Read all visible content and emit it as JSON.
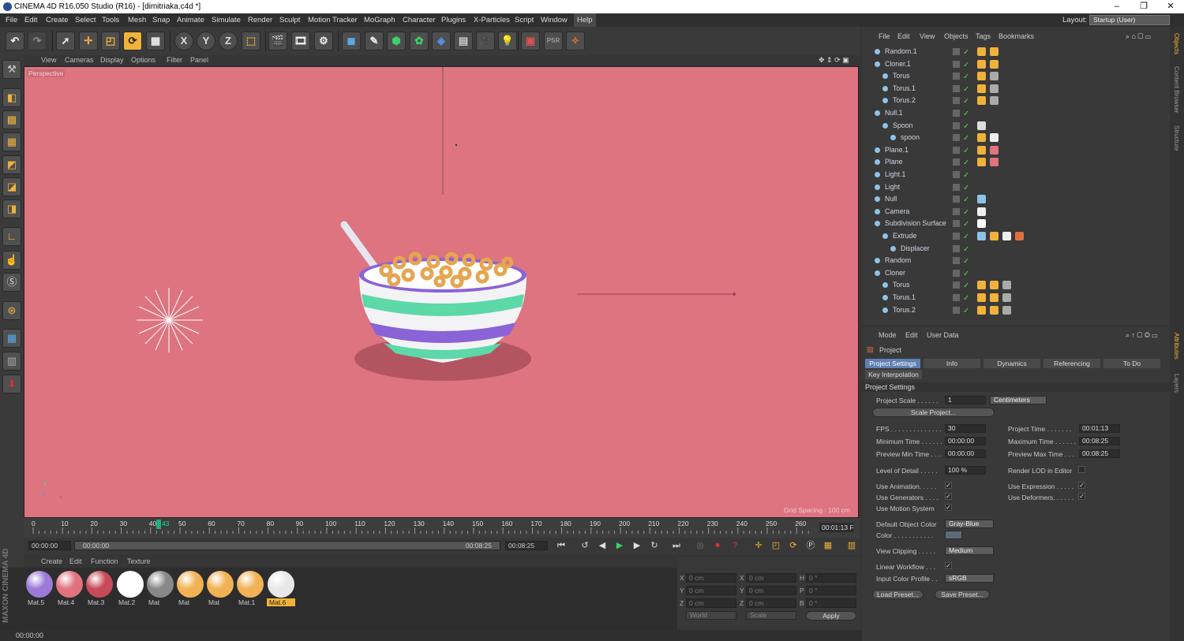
{
  "window": {
    "title": "CINEMA 4D R16.050 Studio (R16) - [dimitriaka.c4d *]",
    "minimize": "–",
    "maximize": "❐",
    "close": "✕"
  },
  "menu": [
    "File",
    "Edit",
    "Create",
    "Select",
    "Tools",
    "Mesh",
    "Snap",
    "Animate",
    "Simulate",
    "Render",
    "Sculpt",
    "Motion Tracker",
    "MoGraph",
    "Character",
    "Plugins",
    "X-Particles",
    "Script",
    "Window",
    "Help"
  ],
  "layout": {
    "label": "Layout:",
    "value": "Startup (User)"
  },
  "toolbar": {
    "x": "X",
    "y": "Y",
    "z": "Z",
    "psr": "PSR 0"
  },
  "viewport": {
    "menu": [
      "View",
      "Cameras",
      "Display",
      "Options",
      "Filter",
      "Panel"
    ],
    "label": "Perspective",
    "grid_spacing": "Grid Spacing : 100 cm",
    "bg_color": "#dd7480"
  },
  "timeline": {
    "ticks": [
      "0",
      "10",
      "20",
      "30",
      "40",
      "50",
      "60",
      "70",
      "80",
      "90",
      "100",
      "110",
      "120",
      "130",
      "140",
      "150",
      "160",
      "170",
      "180",
      "190",
      "200",
      "210",
      "220",
      "230",
      "240",
      "250",
      "260"
    ],
    "current_frame": "43",
    "current_time": "00:01:13 F",
    "start": "00:00:00",
    "range_start": "00:00:00",
    "range_end": "00:08:25",
    "end": "00:08:25"
  },
  "materials": {
    "menu": [
      "Create",
      "Edit",
      "Function",
      "Texture"
    ],
    "items": [
      {
        "name": "Mat.5",
        "color": "#9b7ad8"
      },
      {
        "name": "Mat.4",
        "color": "#e0737e"
      },
      {
        "name": "Mat.3",
        "color": "#c84a58"
      },
      {
        "name": "Mat.2",
        "color": "#ffffff"
      },
      {
        "name": "Mat",
        "color": "#888888"
      },
      {
        "name": "Mat",
        "color": "#f0b255"
      },
      {
        "name": "Mat",
        "color": "#f0b255"
      },
      {
        "name": "Mat.1",
        "color": "#f0b255"
      },
      {
        "name": "Mat.6",
        "color": "#e8e8e8"
      }
    ],
    "brand": "MAXON CINEMA 4D"
  },
  "coords": {
    "x": "X",
    "y": "Y",
    "z": "Z",
    "h": "H",
    "p": "P",
    "b": "B",
    "pos_x": "0 cm",
    "pos_y": "0 cm",
    "pos_z": "0 cm",
    "size_x": "0 cm",
    "size_y": "0 cm",
    "size_z": "0 cm",
    "rot_h": "0 °",
    "rot_p": "0 °",
    "rot_b": "0 °",
    "mode1": "World",
    "mode2": "Scale",
    "apply": "Apply"
  },
  "status": "00:00:00",
  "objects": {
    "menu": [
      "File",
      "Edit",
      "View",
      "Objects",
      "Tags",
      "Bookmarks"
    ],
    "rows": [
      {
        "name": "Random.1",
        "indent": 0
      },
      {
        "name": "Cloner.1",
        "indent": 0
      },
      {
        "name": "Torus",
        "indent": 1
      },
      {
        "name": "Torus.1",
        "indent": 1
      },
      {
        "name": "Torus.2",
        "indent": 1
      },
      {
        "name": "Null.1",
        "indent": 0
      },
      {
        "name": "Spoon",
        "indent": 1
      },
      {
        "name": "spoon",
        "indent": 2
      },
      {
        "name": "Plane.1",
        "indent": 0
      },
      {
        "name": "Plane",
        "indent": 0
      },
      {
        "name": "Light.1",
        "indent": 0
      },
      {
        "name": "Light",
        "indent": 0
      },
      {
        "name": "Null",
        "indent": 0
      },
      {
        "name": "Camera",
        "indent": 0
      },
      {
        "name": "Subdivision Surface",
        "indent": 0
      },
      {
        "name": "Extrude",
        "indent": 1
      },
      {
        "name": "Displacer",
        "indent": 2
      },
      {
        "name": "Random",
        "indent": 0
      },
      {
        "name": "Cloner",
        "indent": 0
      },
      {
        "name": "Torus",
        "indent": 1
      },
      {
        "name": "Torus.1",
        "indent": 1
      },
      {
        "name": "Torus.2",
        "indent": 1
      }
    ]
  },
  "attributes": {
    "menu": [
      "Mode",
      "Edit",
      "User Data"
    ],
    "title": "Project",
    "tabs": [
      "Project Settings",
      "Info",
      "Dynamics",
      "Referencing",
      "To Do"
    ],
    "subtab": "Key Interpolation",
    "section": "Project Settings",
    "project_scale_label": "Project Scale . . . . . .",
    "project_scale": "1",
    "units": "Centimeters",
    "scale_project": "Scale Project...",
    "fps_label": "FPS . . . . . . . . . . . . . .",
    "fps": "30",
    "project_time_label": "Project Time . . . . . . .",
    "project_time": "00:01:13",
    "min_time_label": "Minimum Time . . . . . .",
    "min_time": "00:00:00",
    "max_time_label": "Maximum Time . . . . . .",
    "max_time": "00:08:25",
    "pmin_label": "Preview Min Time . . .",
    "pmin": "00:00:00",
    "pmax_label": "Preview Max Time . . .",
    "pmax": "00:08:25",
    "lod_label": "Level of Detail . . . . .",
    "lod": "100 %",
    "render_lod_label": "Render LOD in Editor",
    "use_anim": "Use Animation. . . . .",
    "use_expr": "Use Expression . . . . .",
    "use_gen": "Use Generators . . . .",
    "use_def": "Use Deformers. . . . . .",
    "use_motion": "Use Motion System",
    "def_color_label": "Default Object Color",
    "def_color": "Gray-Blue",
    "color_label": "Color . . . . . . . . . . .",
    "view_clip_label": "View Clipping . . . . .",
    "view_clip": "Medium",
    "linear_label": "Linear Workflow . . .",
    "icp_label": "Input Color Profile . .",
    "icp": "sRGB",
    "load_preset": "Load Preset...",
    "save_preset": "Save Preset..."
  },
  "side_tabs": [
    "Objects",
    "Content Browser",
    "Structure",
    "Attributes",
    "Layers"
  ]
}
